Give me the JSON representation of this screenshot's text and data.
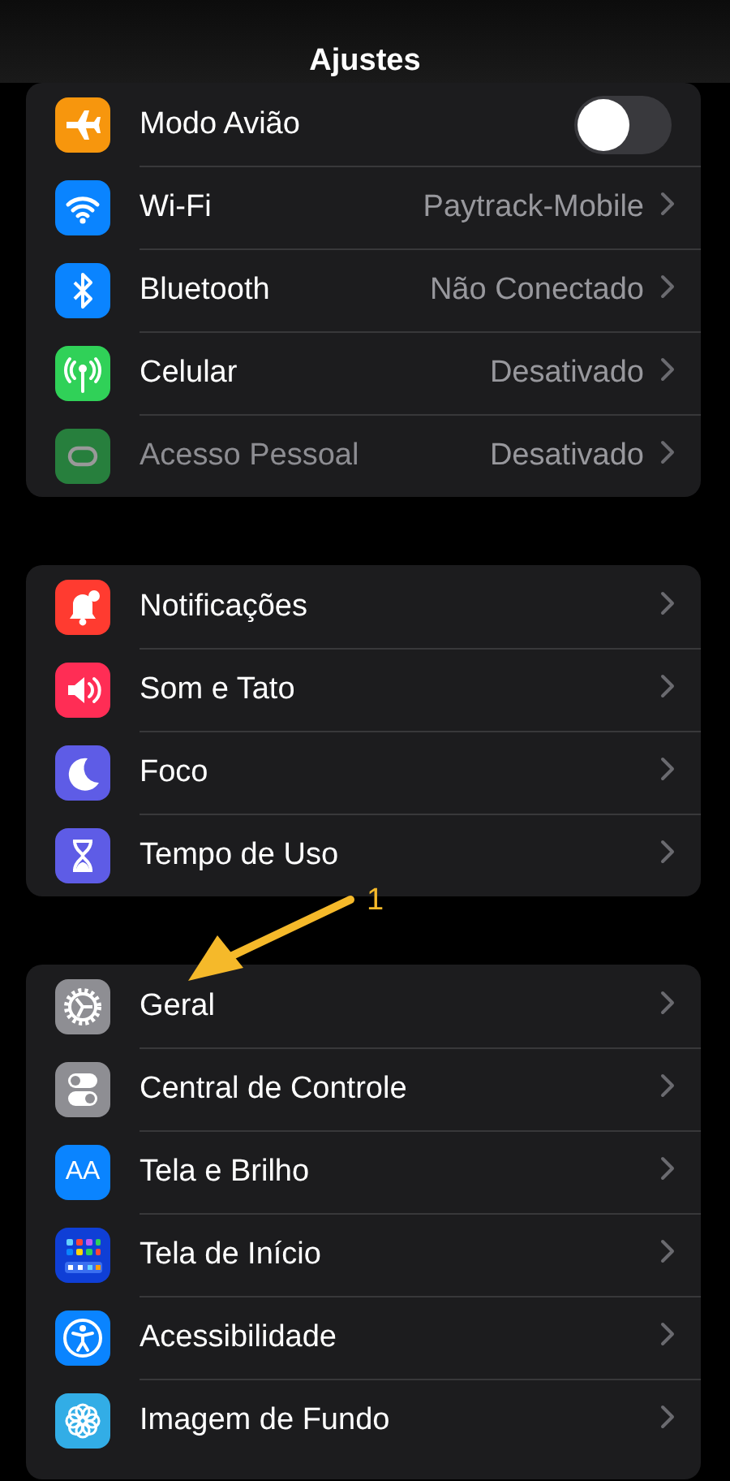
{
  "header": {
    "title": "Ajustes"
  },
  "groups": [
    {
      "rows": [
        {
          "kind": "toggle",
          "label": "Modo Avião",
          "on": false
        },
        {
          "kind": "link",
          "label": "Wi-Fi",
          "value": "Paytrack-Mobile",
          "disabled": false
        },
        {
          "kind": "link",
          "label": "Bluetooth",
          "value": "Não Conectado",
          "disabled": false
        },
        {
          "kind": "link",
          "label": "Celular",
          "value": "Desativado",
          "disabled": false
        },
        {
          "kind": "link",
          "label": "Acesso Pessoal",
          "value": "Desativado",
          "disabled": true
        }
      ]
    },
    {
      "rows": [
        {
          "kind": "link",
          "label": "Notificações",
          "disabled": false
        },
        {
          "kind": "link",
          "label": "Som e Tato",
          "disabled": false
        },
        {
          "kind": "link",
          "label": "Foco",
          "disabled": false
        },
        {
          "kind": "link",
          "label": "Tempo de Uso",
          "disabled": false
        }
      ]
    },
    {
      "rows": [
        {
          "kind": "link",
          "label": "Geral",
          "disabled": false
        },
        {
          "kind": "link",
          "label": "Central de Controle",
          "disabled": false
        },
        {
          "kind": "link",
          "label": "Tela e Brilho",
          "icon_text": "AA",
          "disabled": false
        },
        {
          "kind": "link",
          "label": "Tela de Início",
          "disabled": false
        },
        {
          "kind": "link",
          "label": "Acessibilidade",
          "disabled": false
        },
        {
          "kind": "link",
          "label": "Imagem de Fundo",
          "disabled": false
        }
      ]
    }
  ],
  "annotation": {
    "label": "1"
  }
}
